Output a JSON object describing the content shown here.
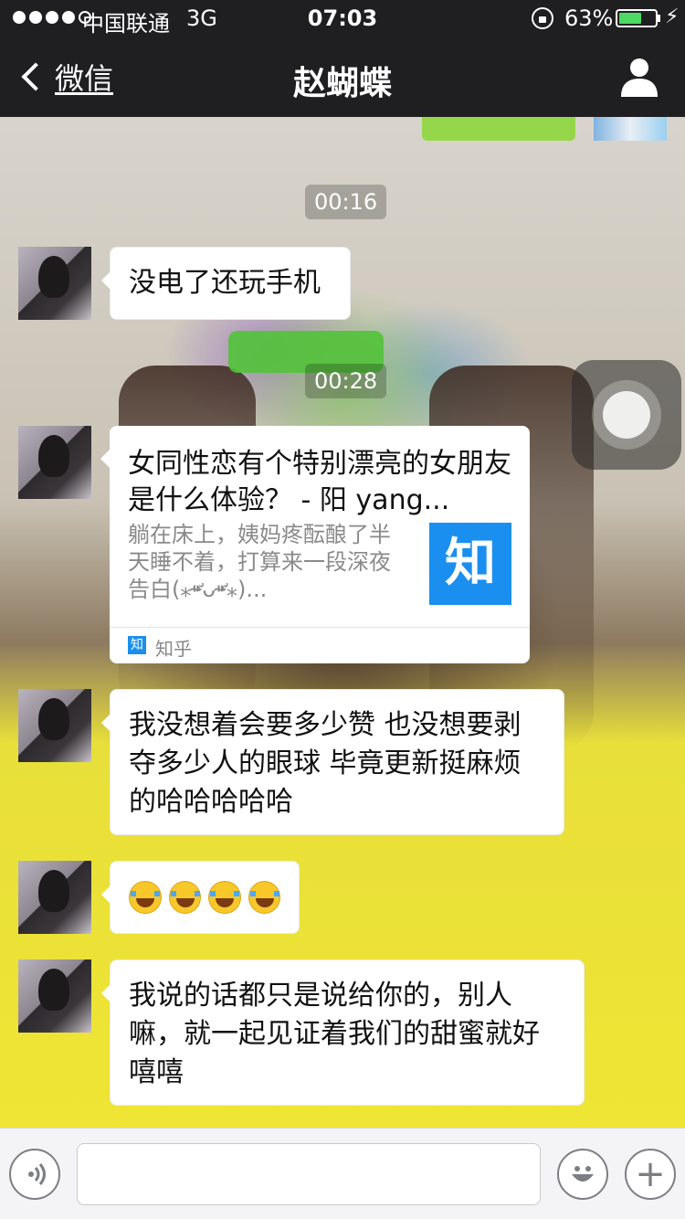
{
  "status_bar": {
    "carrier": "中国联通",
    "network": "3G",
    "time": "07:03",
    "battery_percent": "63%",
    "battery_level": 0.63,
    "signal_bars_filled": 4,
    "signal_bars_total": 5
  },
  "nav": {
    "back_label": "微信",
    "title": "赵蝴蝶"
  },
  "messages": {
    "timestamp_1": "00:16",
    "timestamp_2": "00:28",
    "msg_1": "没电了还玩手机",
    "link_card": {
      "title": "女同性恋有个特别漂亮的女朋友是什么体验？ - 阳 yang...",
      "description": "躺在床上，姨妈疼酝酿了半天睡不着，打算来一段深夜告白(⁎⁍̴̛ᴗ⁍̴̛⁎)...",
      "thumb_text": "知",
      "source_icon_text": "知",
      "source": "知乎"
    },
    "msg_3": "我没想着会要多少赞 也没想要剥夺多少人的眼球 毕竟更新挺麻烦的哈哈哈哈哈",
    "msg_4_emoji_count": 4,
    "msg_5": "我说的话都只是说给你的，别人嘛，就一起见证着我们的甜蜜就好嘻嘻"
  },
  "colors": {
    "nav_bg": "#1f1f21",
    "accent_green": "#96d64a",
    "zhihu_blue": "#1a8ff0",
    "battery_green": "#4cd964"
  },
  "icons": {
    "back": "chevron-left-icon",
    "profile": "person-icon",
    "voice": "voice-icon",
    "emoji": "smiley-icon",
    "plus": "plus-icon"
  }
}
